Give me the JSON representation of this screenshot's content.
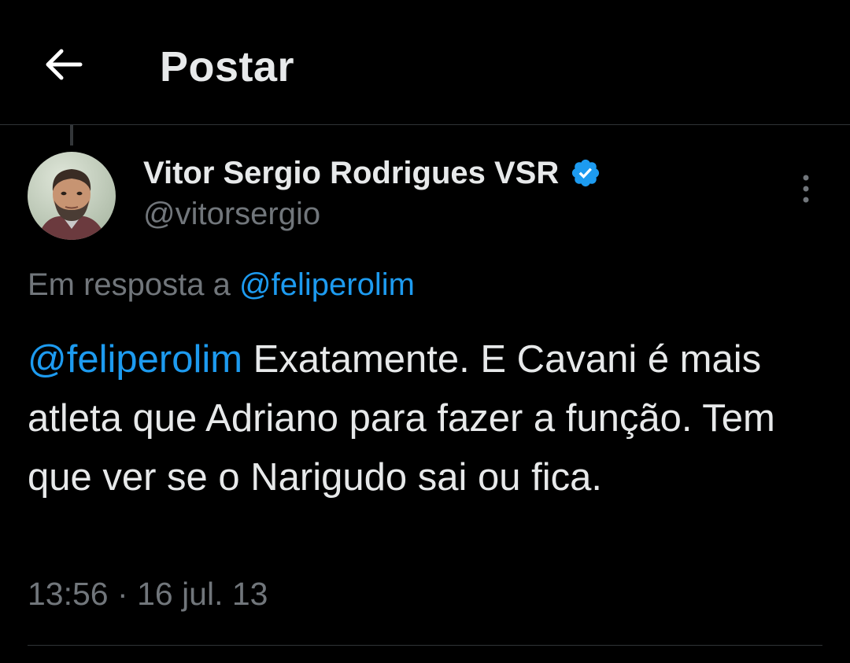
{
  "header": {
    "back_icon": "arrow-left-icon",
    "title": "Postar"
  },
  "post": {
    "author": {
      "display_name": "Vitor Sergio Rodrigues VSR",
      "handle": "@vitorsergio",
      "verified_icon": "verified-badge-icon",
      "avatar_icon": "user-avatar"
    },
    "more_icon": "more-vertical-icon",
    "reply_context": {
      "prefix": "Em resposta a",
      "mention": "@feliperolim"
    },
    "body": {
      "mention": "@feliperolim",
      "text": "Exatamente. E Cavani é mais atleta que Adriano para fazer a função. Tem que ver se o Narigudo sai ou fica."
    },
    "time": "13:56",
    "separator": "·",
    "date": "16 jul. 13"
  },
  "colors": {
    "background": "#000000",
    "text_primary": "#e7e9ea",
    "text_secondary": "#71767b",
    "accent": "#1d9bf0",
    "divider": "#2f3336"
  }
}
